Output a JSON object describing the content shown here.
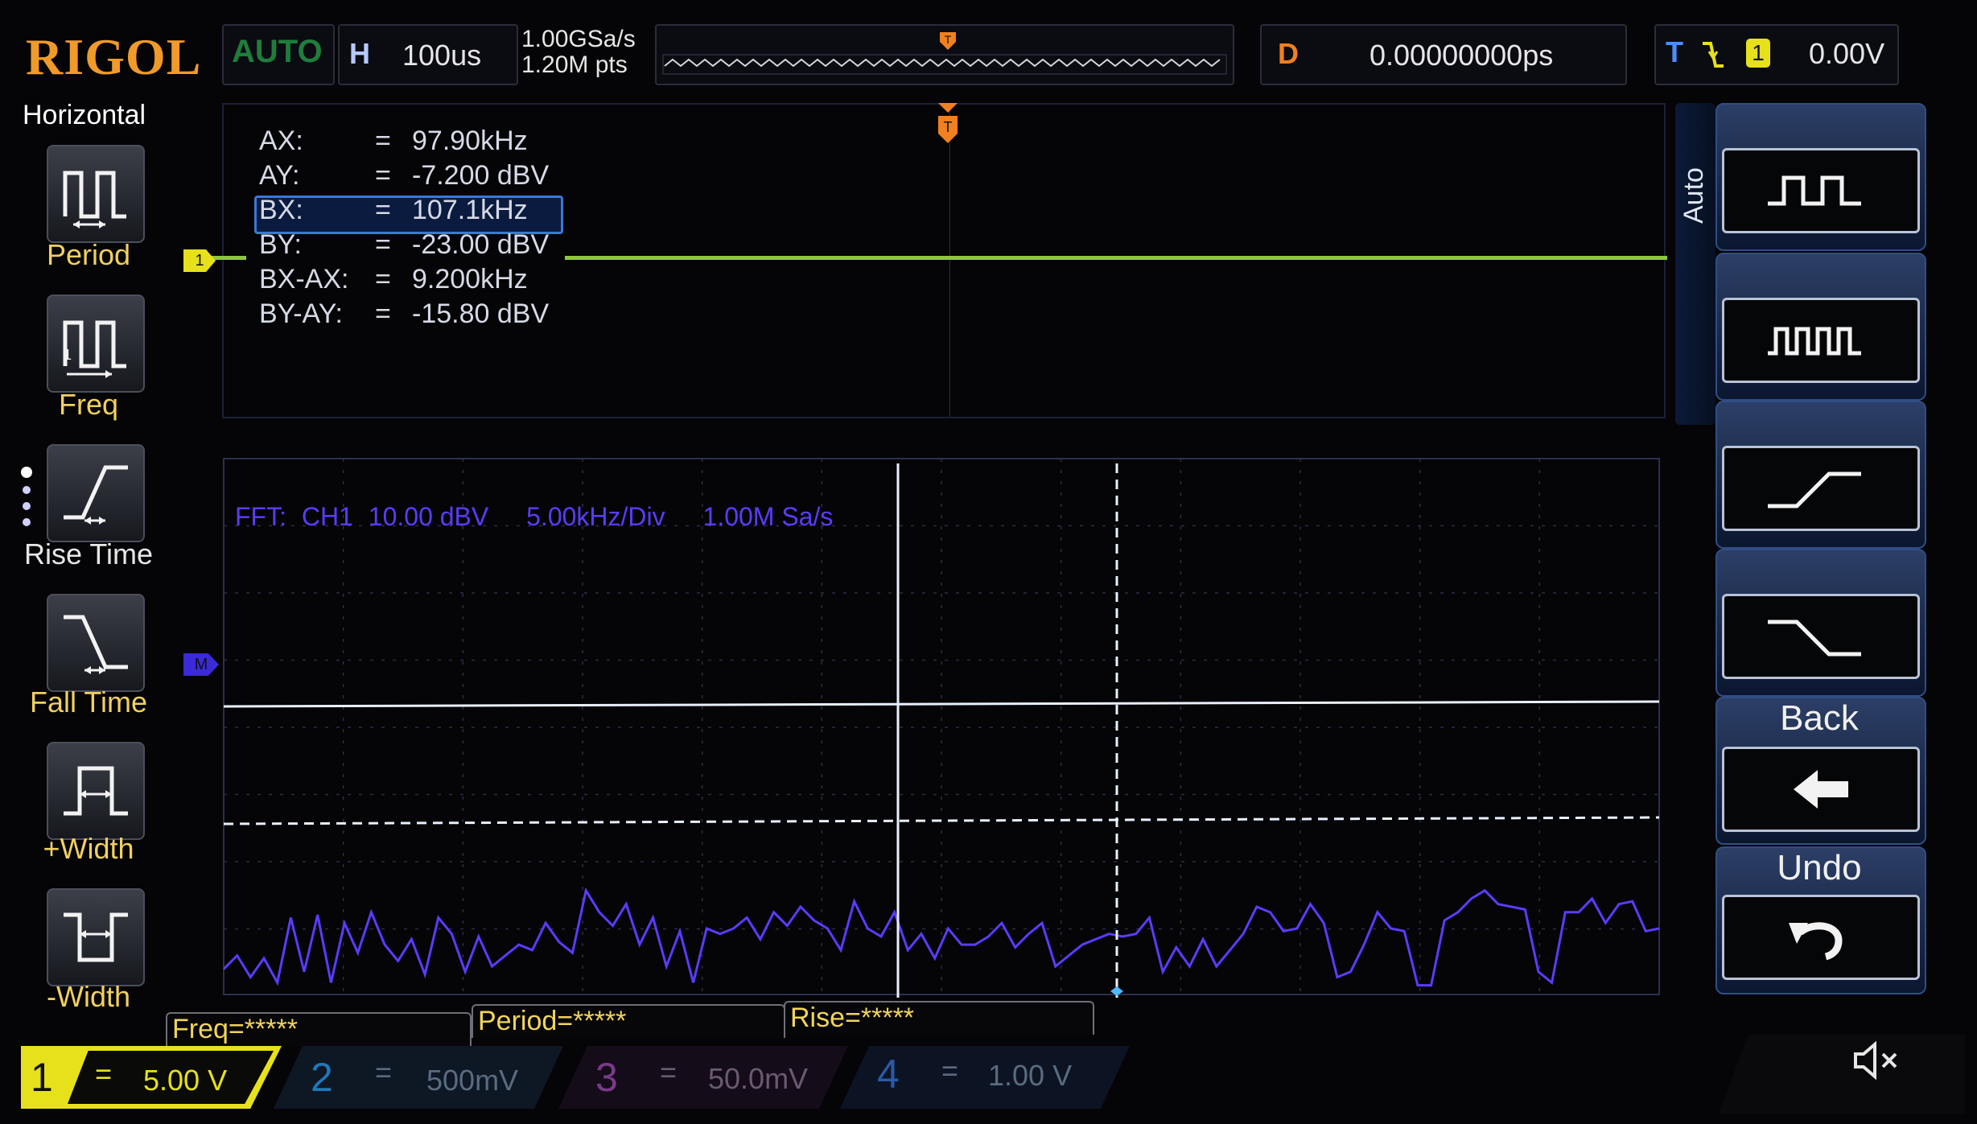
{
  "brand": "RIGOL",
  "top_bar": {
    "trigger_mode": "AUTO",
    "h_label": "H",
    "timebase": "100us",
    "sample_rate": "1.00GSa/s",
    "memory_depth": "1.20M pts",
    "delay_label": "D",
    "delay_value": "0.00000000ps",
    "trigger_label": "T",
    "trigger_channel": "1",
    "trigger_level": "0.00V"
  },
  "left_menu": {
    "title": "Horizontal",
    "items": [
      {
        "label": "Period",
        "icon": "period-icon"
      },
      {
        "label": "Freq",
        "icon": "freq-icon"
      },
      {
        "label": "Rise Time",
        "icon": "rise-time-icon"
      },
      {
        "label": "Fall Time",
        "icon": "fall-time-icon"
      },
      {
        "label": "+Width",
        "icon": "positive-width-icon"
      },
      {
        "label": "-Width",
        "icon": "negative-width-icon"
      }
    ]
  },
  "cursor_readout": [
    {
      "name": "AX:",
      "eq": "=",
      "value": "97.90kHz"
    },
    {
      "name": "AY:",
      "eq": "=",
      "value": "-7.200 dBV"
    },
    {
      "name": "BX:",
      "eq": "=",
      "value": "107.1kHz"
    },
    {
      "name": "BY:",
      "eq": "=",
      "value": "-23.00 dBV"
    },
    {
      "name": "BX-AX:",
      "eq": "=",
      "value": "9.200kHz"
    },
    {
      "name": "BY-AY:",
      "eq": "=",
      "value": "-15.80 dBV"
    }
  ],
  "ch1_marker": "1",
  "fft_info": {
    "label": "FFT:",
    "source": "CH1",
    "scale": "10.00 dBV",
    "span": "5.00kHz/Div",
    "rate": "1.00M Sa/s"
  },
  "fft_marker": "M",
  "right_menu": {
    "auto_label": "Auto",
    "buttons": [
      "pulse-train-wide-icon",
      "pulse-train-narrow-icon",
      "rising-edge-icon",
      "falling-edge-icon"
    ],
    "back_label": "Back",
    "undo_label": "Undo"
  },
  "measure_bar": {
    "freq": "Freq=*****",
    "period": "Period=*****",
    "rise": "Rise=*****"
  },
  "channels": [
    {
      "num": "1",
      "coupling": "=",
      "scale": "5.00 V",
      "color": "#e6e11a"
    },
    {
      "num": "2",
      "coupling": "=",
      "scale": "500mV",
      "color": "#1fa0e0"
    },
    {
      "num": "3",
      "coupling": "=",
      "scale": "50.0mV",
      "color": "#c040c0"
    },
    {
      "num": "4",
      "coupling": "=",
      "scale": "1.00 V",
      "color": "#2a72e0"
    }
  ],
  "colors": {
    "brand": "#f09a2a",
    "ch1_trace": "#8ec63f",
    "fft_trace": "#5a3cff",
    "cursor": "#e8f0ff",
    "menu_label": "#f0d060",
    "trigger_marker": "#f08020"
  },
  "spectrum_levels_dbv": [
    -79,
    -74,
    -82,
    -75,
    -84,
    -60,
    -80,
    -59,
    -84,
    -62,
    -73,
    -58,
    -70,
    -76,
    -68,
    -81,
    -60,
    -66,
    -80,
    -67,
    -78,
    -74,
    -70,
    -72,
    -62,
    -69,
    -73,
    -50,
    -58,
    -63,
    -55,
    -70,
    -60,
    -78,
    -65,
    -84,
    -64,
    -66,
    -64,
    -60,
    -68,
    -58,
    -63,
    -56,
    -61,
    -64,
    -72,
    -54,
    -64,
    -67,
    -58,
    -72,
    -66,
    -75,
    -64,
    -70,
    -70,
    -67,
    -62,
    -71,
    -66,
    -62,
    -78,
    -74,
    -70,
    -68,
    -66,
    -67,
    -66,
    -60,
    -80,
    -71,
    -78,
    -68,
    -78,
    -72,
    -66,
    -56,
    -58,
    -65,
    -64,
    -55,
    -62,
    -82,
    -80,
    -70,
    -58,
    -64,
    -65,
    -85,
    -85,
    -61,
    -58,
    -53,
    -50,
    -55,
    -56,
    -57,
    -80,
    -84,
    -58,
    -58,
    -53,
    -62,
    -55,
    -54,
    -65,
    -64
  ]
}
